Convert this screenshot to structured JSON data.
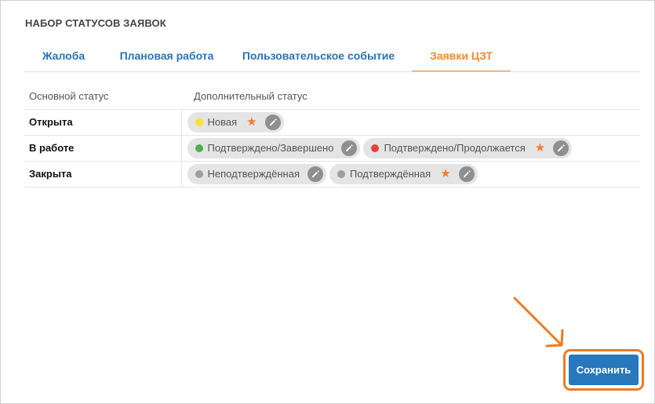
{
  "panel": {
    "title": "НАБОР СТАТУСОВ ЗАЯВОК"
  },
  "tabs": [
    {
      "label": "Жалоба",
      "active": false
    },
    {
      "label": "Плановая работа",
      "active": false
    },
    {
      "label": "Пользовательское событие",
      "active": false
    },
    {
      "label": "Заявки ЦЗТ",
      "active": true
    }
  ],
  "table": {
    "headers": {
      "main": "Основной статус",
      "extra": "Дополнительный статус"
    },
    "rows": [
      {
        "main": "Открыта",
        "chips": [
          {
            "label": "Новая",
            "dot_color": "#f5e52a",
            "starred": true
          }
        ]
      },
      {
        "main": "В работе",
        "chips": [
          {
            "label": "Подтверждено/Завершено",
            "dot_color": "#4caf50",
            "starred": false
          },
          {
            "label": "Подтверждено/Продолжается",
            "dot_color": "#e8403a",
            "starred": true
          }
        ]
      },
      {
        "main": "Закрыта",
        "chips": [
          {
            "label": "Неподтверждённая",
            "dot_color": "#9e9e9e",
            "starred": false
          },
          {
            "label": "Подтверждённая",
            "dot_color": "#9e9e9e",
            "starred": true
          }
        ]
      }
    ]
  },
  "actions": {
    "save_label": "Сохранить"
  },
  "colors": {
    "accent": "#f08c2d",
    "link": "#2a74b8",
    "primary_button": "#2878bd",
    "highlight": "#f07a1e",
    "star": "#f57c2a"
  }
}
